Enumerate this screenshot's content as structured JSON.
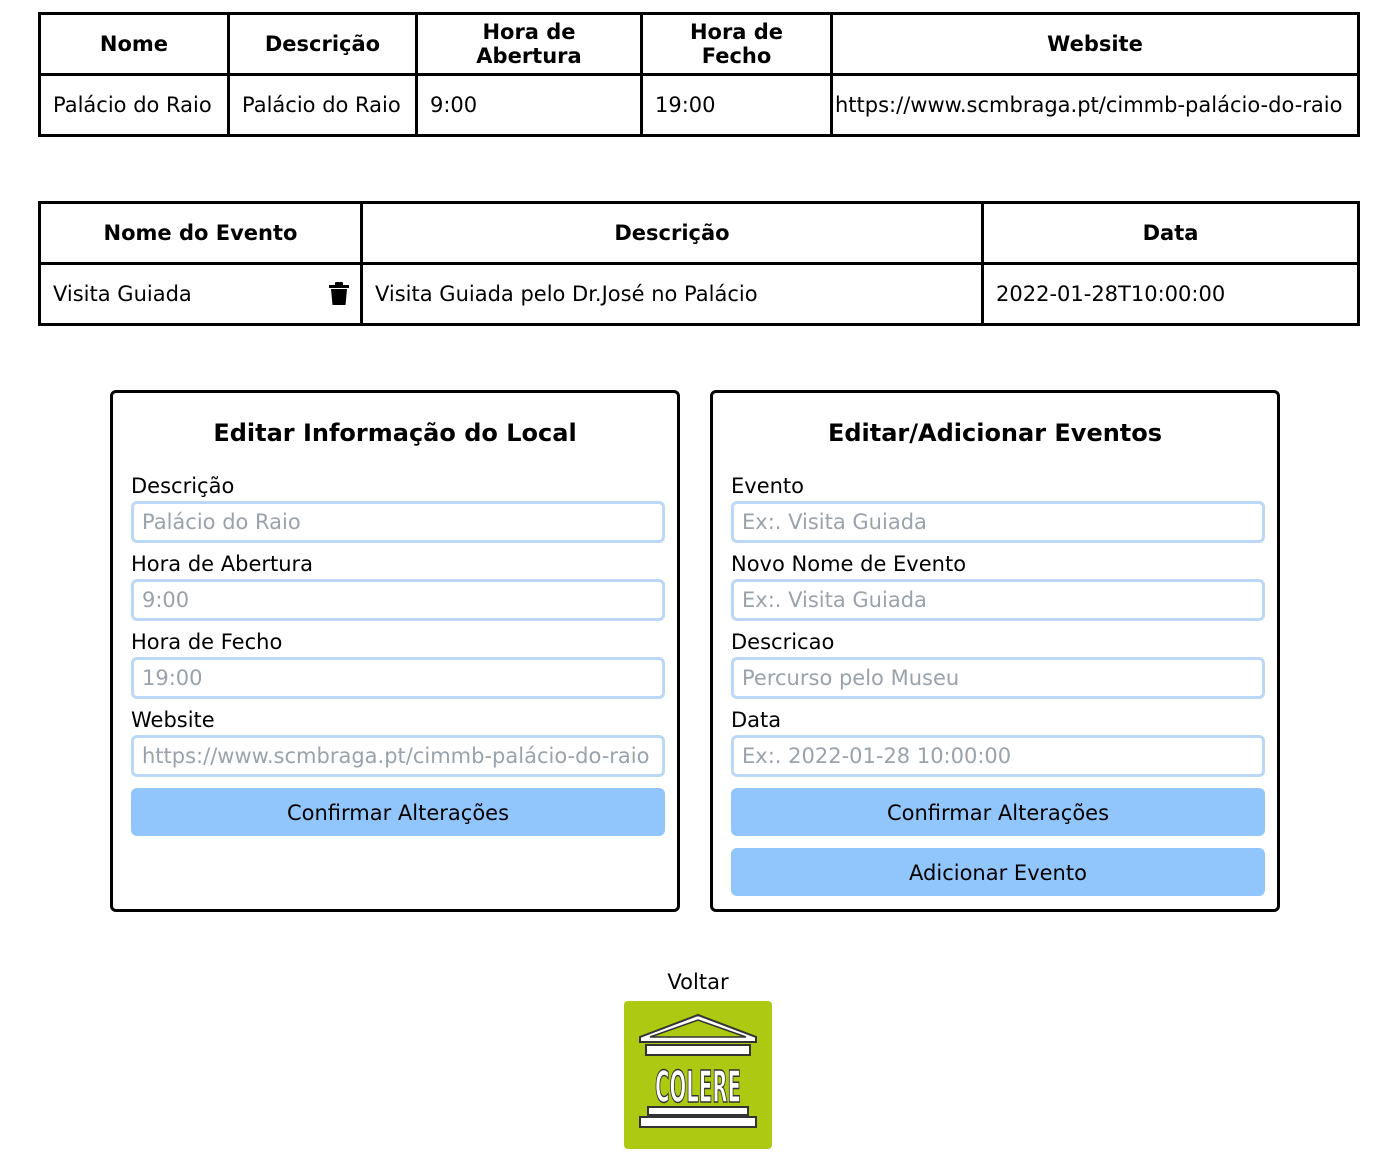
{
  "local_table": {
    "headers": [
      "Nome",
      "Descrição",
      "Hora de Abertura",
      "Hora de Fecho",
      "Website"
    ],
    "row": [
      "Palácio do Raio",
      "Palácio do Raio",
      "9:00",
      "19:00",
      "https://www.scmbraga.pt/cimmb-palácio-do-raio"
    ]
  },
  "events_table": {
    "headers": [
      "Nome do Evento",
      "Descrição",
      "Data"
    ],
    "rows": [
      {
        "name": "Visita Guiada",
        "description": "Visita Guiada pelo Dr.José no Palácio",
        "date": "2022-01-28T10:00:00",
        "delete_icon": "trash-icon"
      }
    ]
  },
  "local_form": {
    "title": "Editar Informação do Local",
    "fields": [
      {
        "label": "Descrição",
        "placeholder": "Palácio do Raio"
      },
      {
        "label": "Hora de Abertura",
        "placeholder": "9:00"
      },
      {
        "label": "Hora de Fecho",
        "placeholder": "19:00"
      },
      {
        "label": "Website",
        "placeholder": "https://www.scmbraga.pt/cimmb-palácio-do-raio"
      }
    ],
    "confirm_label": "Confirmar Alterações"
  },
  "events_form": {
    "title": "Editar/Adicionar Eventos",
    "fields": [
      {
        "label": "Evento",
        "placeholder": "Ex:. Visita Guiada"
      },
      {
        "label": "Novo Nome de Evento",
        "placeholder": "Ex:. Visita Guiada"
      },
      {
        "label": "Descricao",
        "placeholder": "Percurso pelo Museu"
      },
      {
        "label": "Data",
        "placeholder": "Ex:. 2022-01-28 10:00:00"
      }
    ],
    "confirm_label": "Confirmar Alterações",
    "add_label": "Adicionar Evento"
  },
  "back_label": "Voltar",
  "logo": {
    "text": "COLERE",
    "background": "#adc912"
  },
  "colors": {
    "button": "#90c6fb",
    "input_border": "#bcd8f8"
  }
}
